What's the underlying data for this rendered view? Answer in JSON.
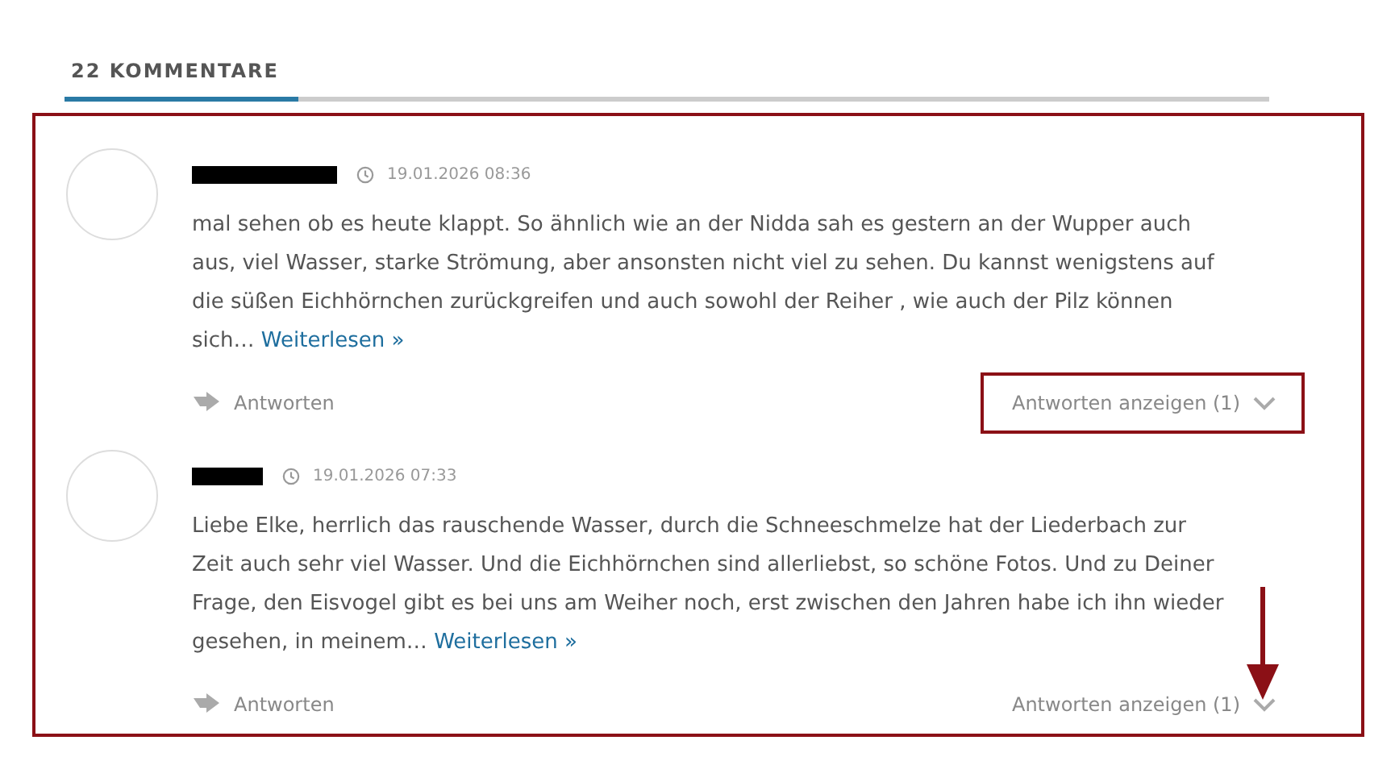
{
  "heading": "22 KOMMENTARE",
  "comments": [
    {
      "date": "19.01.2026 08:36",
      "text": "mal sehen ob es heute klappt. So ähnlich wie an der Nidda sah es gestern an der Wupper auch aus, viel Wasser, starke Strömung, aber ansonsten nicht viel zu sehen. Du kannst wenigstens auf die süßen Eichhörnchen zurückgreifen und auch sowohl der Reiher , wie auch der Pilz können sich…",
      "link": "Weiterlesen »",
      "reply": "Antworten",
      "show_replies": "Antworten anzeigen (1)",
      "highlighted": true,
      "arrow": false
    },
    {
      "date": "19.01.2026 07:33",
      "text": "Liebe Elke, herrlich das rauschende Wasser, durch die Schneeschmelze hat der Liederbach zur Zeit auch sehr viel Wasser. Und die Eichhörnchen sind allerliebst, so schöne Fotos. Und zu Deiner Frage, den Eisvogel gibt es bei uns am Weiher noch, erst zwischen den Jahren habe ich ihn wieder gesehen, in meinem…",
      "link": "Weiterlesen »",
      "reply": "Antworten",
      "show_replies": "Antworten anzeigen (1)",
      "highlighted": false,
      "arrow": true
    }
  ]
}
